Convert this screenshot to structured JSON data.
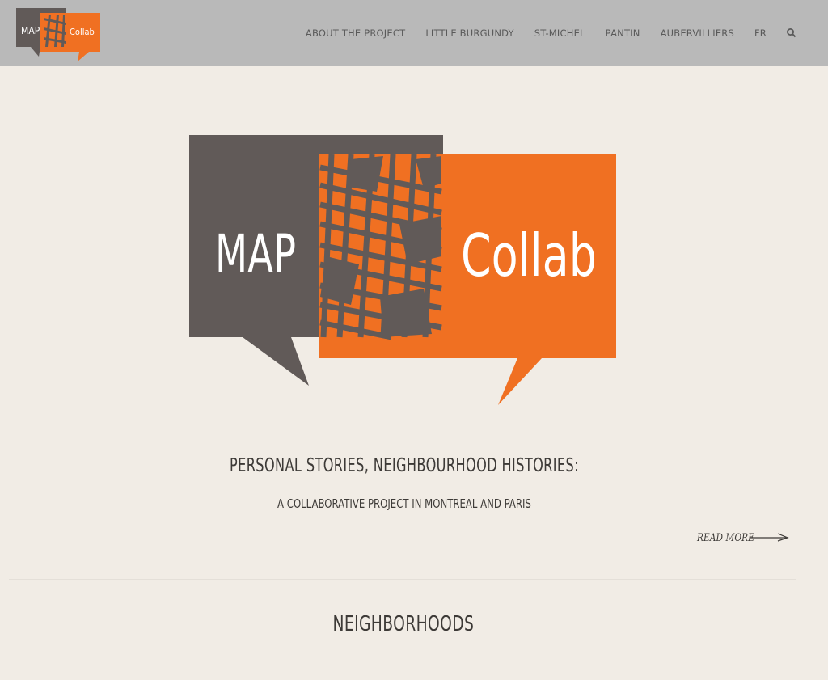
{
  "header": {
    "logo": {
      "word1": "MAP",
      "word2": "Collab"
    },
    "nav": [
      {
        "label": "ABOUT THE PROJECT"
      },
      {
        "label": "LITTLE BURGUNDY"
      },
      {
        "label": "ST-MICHEL"
      },
      {
        "label": "PANTIN"
      },
      {
        "label": "AUBERVILLIERS"
      },
      {
        "label": "FR"
      }
    ],
    "search_icon": "search-icon"
  },
  "hero": {
    "logo": {
      "word1": "MAP",
      "word2": "Collab"
    },
    "tagline": "PERSONAL STORIES, NEIGHBOURHOOD HISTORIES:",
    "subtagline": "A COLLABORATIVE PROJECT IN MONTREAL AND PARIS",
    "read_more": "READ MORE"
  },
  "sections": {
    "neighborhoods_title": "NEIGHBORHOODS"
  },
  "colors": {
    "header_bg": "#b9b9b9",
    "page_bg": "#f1ece5",
    "brand_gray": "#615a58",
    "brand_orange": "#f07022",
    "text": "#3d3a37"
  }
}
